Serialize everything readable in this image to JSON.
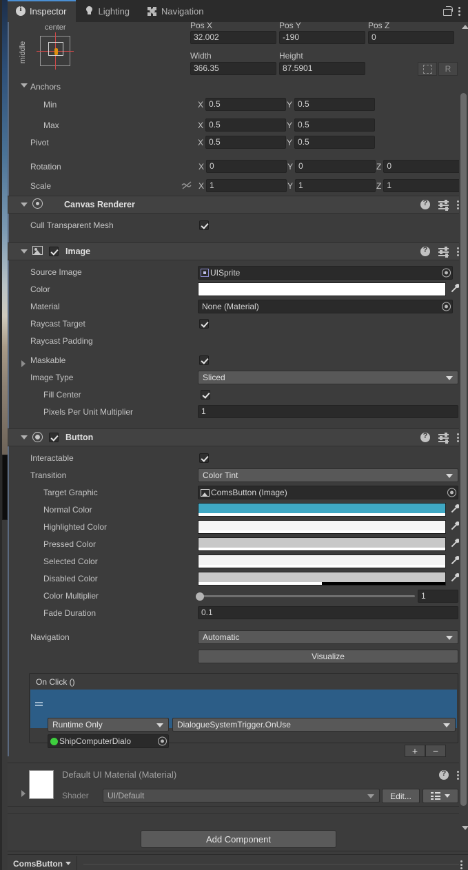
{
  "window": {
    "tabs": [
      {
        "label": "Inspector",
        "icon": "info-icon",
        "active": true
      },
      {
        "label": "Lighting",
        "icon": "lightbulb-icon",
        "active": false
      },
      {
        "label": "Navigation",
        "icon": "navigation-icon",
        "active": false
      }
    ],
    "lock_icon": "lock-open-icon",
    "menu_icon": "kebab-menu-icon"
  },
  "rect_transform": {
    "anchor_preset": {
      "horizontal": "center",
      "vertical": "middle"
    },
    "pos_x": {
      "label": "Pos X",
      "value": "32.002"
    },
    "pos_y": {
      "label": "Pos Y",
      "value": "-190"
    },
    "pos_z": {
      "label": "Pos Z",
      "value": "0"
    },
    "width": {
      "label": "Width",
      "value": "366.35"
    },
    "height": {
      "label": "Height",
      "value": "87.5901"
    },
    "blueprint_button": "blueprint-mode-icon",
    "rawedit_button": "R",
    "anchors_label": "Anchors",
    "min": {
      "label": "Min",
      "x": "0.5",
      "y": "0.5"
    },
    "max": {
      "label": "Max",
      "x": "0.5",
      "y": "0.5"
    },
    "pivot": {
      "label": "Pivot",
      "x": "0.5",
      "y": "0.5"
    },
    "rotation": {
      "label": "Rotation",
      "x": "0",
      "y": "0",
      "z": "0"
    },
    "scale": {
      "label": "Scale",
      "x": "1",
      "y": "1",
      "z": "1",
      "link_icon": "link-off-icon"
    },
    "axis_x": "X",
    "axis_y": "Y",
    "axis_z": "Z"
  },
  "canvas_renderer": {
    "title": "Canvas Renderer",
    "icon": "eye-icon",
    "cull_transparent_mesh": {
      "label": "Cull Transparent Mesh",
      "checked": true
    }
  },
  "image": {
    "title": "Image",
    "icon": "image-icon",
    "enabled": true,
    "source_image": {
      "label": "Source Image",
      "value": "UISprite",
      "icon": "sprite-icon"
    },
    "color": {
      "label": "Color",
      "value": "#FFFFFF",
      "alpha": 1.0
    },
    "material": {
      "label": "Material",
      "value": "None (Material)"
    },
    "raycast_target": {
      "label": "Raycast Target",
      "checked": true
    },
    "raycast_padding": {
      "label": "Raycast Padding"
    },
    "maskable": {
      "label": "Maskable",
      "checked": true
    },
    "image_type": {
      "label": "Image Type",
      "value": "Sliced"
    },
    "fill_center": {
      "label": "Fill Center",
      "checked": true
    },
    "pixels_per_unit_multiplier": {
      "label": "Pixels Per Unit Multiplier",
      "value": "1"
    }
  },
  "button": {
    "title": "Button",
    "icon": "button-icon",
    "enabled": true,
    "interactable": {
      "label": "Interactable",
      "checked": true
    },
    "transition": {
      "label": "Transition",
      "value": "Color Tint"
    },
    "target_graphic": {
      "label": "Target Graphic",
      "value": "ComsButton (Image)",
      "icon": "image-icon"
    },
    "colors": [
      {
        "label": "Normal Color",
        "value": "#3FA8C4",
        "alpha": 1.0
      },
      {
        "label": "Highlighted Color",
        "value": "#F5F5F5",
        "alpha": 1.0
      },
      {
        "label": "Pressed Color",
        "value": "#C8C8C8",
        "alpha": 1.0
      },
      {
        "label": "Selected Color",
        "value": "#F5F5F5",
        "alpha": 1.0
      },
      {
        "label": "Disabled Color",
        "value": "#C8C8C8",
        "alpha": 0.5
      }
    ],
    "color_multiplier": {
      "label": "Color Multiplier",
      "value": "1",
      "min": 1,
      "max": 5
    },
    "fade_duration": {
      "label": "Fade Duration",
      "value": "0.1"
    },
    "navigation": {
      "label": "Navigation",
      "value": "Automatic"
    },
    "visualize_button": "Visualize",
    "on_click": {
      "header": "On Click ()",
      "entries": [
        {
          "runtime_mode": "Runtime Only",
          "function": "DialogueSystemTrigger.OnUse",
          "object": "ShipComputerDialo",
          "selected": true
        }
      ],
      "add_button": "+",
      "remove_button": "−"
    }
  },
  "material_footer": {
    "title": "Default UI Material (Material)",
    "shader_label": "Shader",
    "shader_value": "UI/Default",
    "edit_button": "Edit...",
    "preset_button": "preset-list-icon"
  },
  "add_component_button": "Add Component",
  "bottom": {
    "tab_label": "ComsButton",
    "menu_icon": "kebab-menu-icon"
  },
  "colors": {
    "panel_bg": "#3c3c3c",
    "header_bg": "#424242",
    "tabbar_bg": "#2b2b2b",
    "field_bg": "#2a2a2a",
    "dropdown_bg": "#585858",
    "accent_blue": "#4a8fd4",
    "selection_blue": "#2c5d87",
    "normal_color_swatch": "#3FA8C4",
    "pivot_marker": "#e0900f",
    "anchor_cross": "#cf4848",
    "green_dot": "#3ecf3e"
  }
}
